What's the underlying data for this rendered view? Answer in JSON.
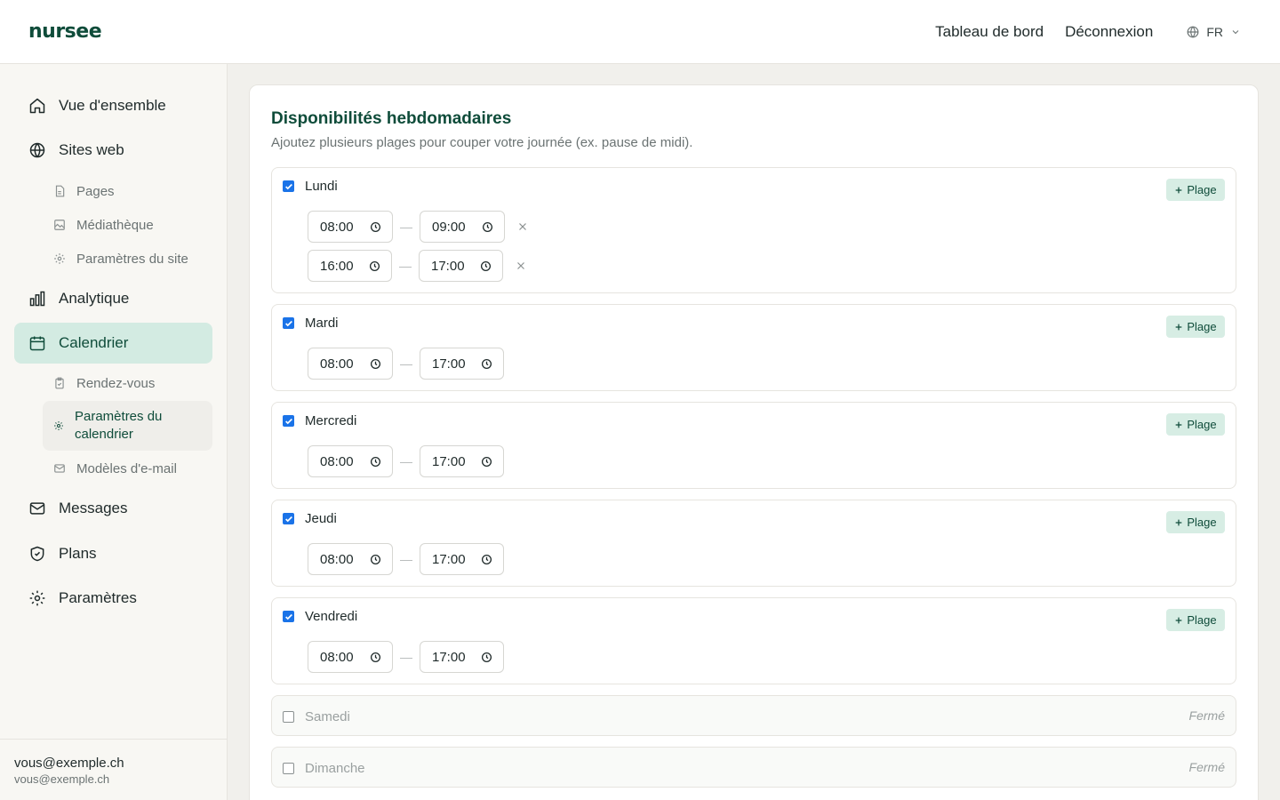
{
  "header": {
    "logo": "nursee",
    "nav": [
      "Tableau de bord",
      "Déconnexion"
    ],
    "language": "FR"
  },
  "sidebar": {
    "items": [
      {
        "label": "Vue d'ensemble",
        "icon": "home-icon"
      },
      {
        "label": "Sites web",
        "icon": "globe-icon"
      },
      {
        "label": "Analytique",
        "icon": "bar-chart-icon"
      },
      {
        "label": "Calendrier",
        "icon": "calendar-icon"
      },
      {
        "label": "Messages",
        "icon": "mail-icon"
      },
      {
        "label": "Plans",
        "icon": "shield-icon"
      },
      {
        "label": "Paramètres",
        "icon": "gear-icon"
      }
    ],
    "sites_sub": [
      {
        "label": "Pages",
        "icon": "file-icon"
      },
      {
        "label": "Médiathèque",
        "icon": "image-icon"
      },
      {
        "label": "Paramètres du site",
        "icon": "gear-icon"
      }
    ],
    "calendar_sub": [
      {
        "label": "Rendez-vous",
        "icon": "clipboard-icon"
      },
      {
        "label": "Paramètres du calendrier",
        "icon": "gear-icon"
      },
      {
        "label": "Modèles d'e-mail",
        "icon": "mail-icon"
      }
    ],
    "user": {
      "name": "vous@exemple.ch",
      "email": "vous@exemple.ch"
    }
  },
  "main": {
    "title": "Disponibilités hebdomadaires",
    "subtitle": "Ajoutez plusieurs plages pour couper votre journée (ex. pause de midi).",
    "add_label": "Plage",
    "closed_label": "Fermé",
    "days": [
      {
        "name": "Lundi",
        "enabled": true,
        "ranges": [
          {
            "start": "08:00",
            "end": "09:00"
          },
          {
            "start": "16:00",
            "end": "17:00"
          }
        ]
      },
      {
        "name": "Mardi",
        "enabled": true,
        "ranges": [
          {
            "start": "08:00",
            "end": "17:00"
          }
        ]
      },
      {
        "name": "Mercredi",
        "enabled": true,
        "ranges": [
          {
            "start": "08:00",
            "end": "17:00"
          }
        ]
      },
      {
        "name": "Jeudi",
        "enabled": true,
        "ranges": [
          {
            "start": "08:00",
            "end": "17:00"
          }
        ]
      },
      {
        "name": "Vendredi",
        "enabled": true,
        "ranges": [
          {
            "start": "08:00",
            "end": "17:00"
          }
        ]
      },
      {
        "name": "Samedi",
        "enabled": false,
        "ranges": []
      },
      {
        "name": "Dimanche",
        "enabled": false,
        "ranges": []
      }
    ]
  }
}
